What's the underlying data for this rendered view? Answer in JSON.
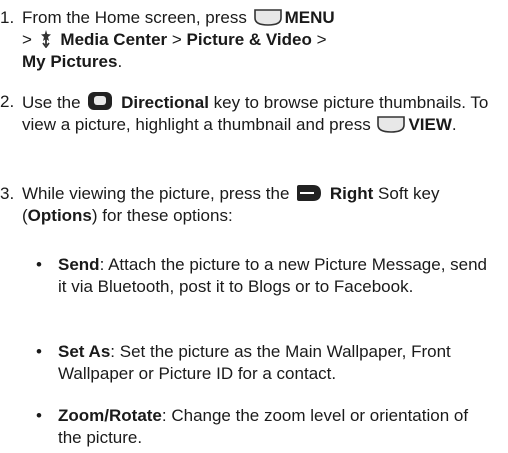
{
  "steps": [
    {
      "num": "1.",
      "t1": "From the Home screen, press",
      "menu_key": "MENU",
      "t2": ">",
      "media_center": "Media Center",
      "t3": "> ",
      "picture_video": "Picture & Video",
      "t4": " >",
      "my_pictures": "My Pictures",
      "t5": "."
    },
    {
      "num": "2.",
      "t1": "Use the",
      "directional": "Directional",
      "t2": "key to browse picture thumbnails. To view a picture, highlight a thumbnail and press",
      "view_key": "VIEW",
      "t3": "."
    },
    {
      "num": "3.",
      "t1": "While viewing the picture, press the",
      "right": "Right",
      "t2": "Soft key (",
      "options": "Options",
      "t3": ") for these options:"
    }
  ],
  "bullets": [
    {
      "dot": "•",
      "term": "Send",
      "desc": ": Attach the picture to a new Picture Message, send it via Bluetooth, post it to Blogs or to Facebook."
    },
    {
      "dot": "•",
      "term": "Set As",
      "desc": ": Set the picture as the Main Wallpaper, Front Wallpaper or Picture ID for a contact."
    },
    {
      "dot": "•",
      "term": "Zoom/Rotate",
      "desc": ": Change the zoom level or orientation of the picture."
    }
  ],
  "icons": {
    "menu_key": "center-key-icon",
    "media_center": "media-center-icon",
    "directional": "directional-key-icon",
    "view_key": "center-key-icon",
    "right": "right-soft-key-icon"
  }
}
